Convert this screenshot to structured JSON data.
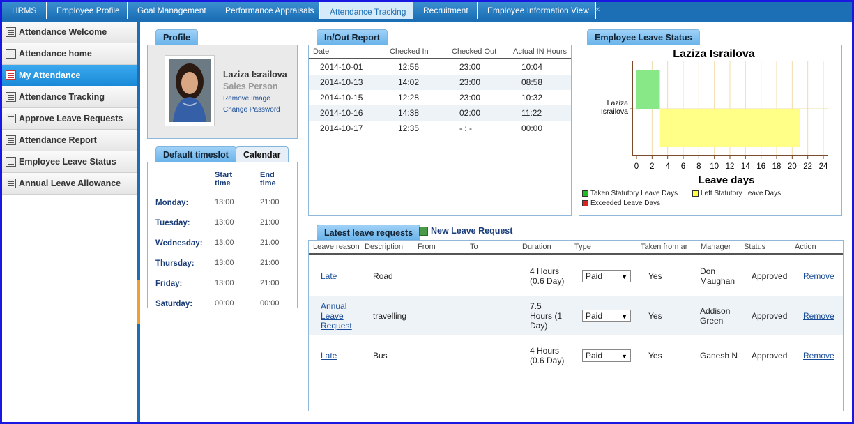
{
  "top_tabs": [
    {
      "label": "HRMS",
      "active": false
    },
    {
      "label": "Employee Profile",
      "active": false
    },
    {
      "label": "Goal Management",
      "active": false
    },
    {
      "label": "Performance Appraisals",
      "active": false
    },
    {
      "label": "Attendance Tracking",
      "active": true
    },
    {
      "label": "Recruitment",
      "active": false
    },
    {
      "label": "Employee Information View",
      "active": false
    }
  ],
  "sidebar": {
    "items": [
      {
        "label": "Attendance Welcome",
        "active": false
      },
      {
        "label": "Attendance home",
        "active": false
      },
      {
        "label": "My Attendance",
        "active": true
      },
      {
        "label": "Attendance Tracking",
        "active": false
      },
      {
        "label": "Approve Leave Requests",
        "active": false
      },
      {
        "label": "Attendance Report",
        "active": false
      },
      {
        "label": "Employee Leave Status",
        "active": false
      },
      {
        "label": "Annual Leave Allowance",
        "active": false
      }
    ]
  },
  "profile": {
    "tab": "Profile",
    "name": "Laziza Israilova",
    "role": "Sales Person",
    "remove_image": "Remove Image",
    "change_password": "Change Password"
  },
  "timeslot": {
    "tab_default": "Default timeslot",
    "tab_calendar": "Calendar",
    "col_start": "Start time",
    "col_end": "End time",
    "rows": [
      {
        "day": "Monday:",
        "start": "13:00",
        "end": "21:00"
      },
      {
        "day": "Tuesday:",
        "start": "13:00",
        "end": "21:00"
      },
      {
        "day": "Wednesday:",
        "start": "13:00",
        "end": "21:00"
      },
      {
        "day": "Thursday:",
        "start": "13:00",
        "end": "21:00"
      },
      {
        "day": "Friday:",
        "start": "13:00",
        "end": "21:00"
      },
      {
        "day": "Saturday:",
        "start": "00:00",
        "end": "00:00"
      }
    ]
  },
  "inout": {
    "tab": "In/Out Report",
    "headers": [
      "Date",
      "Checked In",
      "Checked Out",
      "Actual IN Hours"
    ],
    "rows": [
      [
        "2014-10-01",
        "12:56",
        "23:00",
        "10:04"
      ],
      [
        "2014-10-13",
        "14:02",
        "23:00",
        "08:58"
      ],
      [
        "2014-10-15",
        "12:28",
        "23:00",
        "10:32"
      ],
      [
        "2014-10-16",
        "14:38",
        "02:00",
        "11:22"
      ],
      [
        "2014-10-17",
        "12:35",
        "- : -",
        "00:00"
      ]
    ]
  },
  "leave_status": {
    "tab": "Employee Leave Status",
    "legend": [
      {
        "label": "Taken Statutory Leave Days",
        "color": "#22bb22"
      },
      {
        "label": "Left Statutory Leave Days",
        "color": "#ffff44"
      },
      {
        "label": "Exceeded Leave Days",
        "color": "#dd2222"
      }
    ]
  },
  "chart_data": {
    "type": "bar",
    "title": "Laziza Israilova",
    "xlabel": "Leave days",
    "ylabel": "",
    "categories": [
      "Laziza Israilova"
    ],
    "series": [
      {
        "name": "Taken Statutory Leave Days",
        "start": 0,
        "end": 3,
        "color": "#88e888"
      },
      {
        "name": "Left Statutory Leave Days",
        "start": 3,
        "end": 21,
        "color": "#ffff88"
      }
    ],
    "xlim": [
      0,
      24
    ],
    "xticks": [
      "0",
      "2",
      "4",
      "6",
      "8",
      "10",
      "12",
      "14",
      "16",
      "18",
      "20",
      "22",
      "24"
    ],
    "grid": true
  },
  "leave_requests": {
    "tab": "Latest leave requests",
    "new_link": "New Leave Request",
    "headers": [
      "Leave reason",
      "Description",
      "From",
      "To",
      "Duration",
      "Type",
      "Taken from ar",
      "Manager",
      "Status",
      "Action"
    ],
    "rows": [
      {
        "reason": "Late",
        "description": "Road",
        "from": "",
        "to": "",
        "duration": "4 Hours (0.6 Day)",
        "type": "Paid",
        "taken": "Yes",
        "manager": "Don Maughan",
        "status": "Approved",
        "action": "Remove"
      },
      {
        "reason": "Annual Leave Request",
        "description": "travelling",
        "from": "",
        "to": "",
        "duration": "7.5 Hours (1 Day)",
        "type": "Paid",
        "taken": "Yes",
        "manager": "Addison Green",
        "status": "Approved",
        "action": "Remove"
      },
      {
        "reason": "Late",
        "description": "Bus",
        "from": "",
        "to": "",
        "duration": "4 Hours (0.6 Day)",
        "type": "Paid",
        "taken": "Yes",
        "manager": "Ganesh N",
        "status": "Approved",
        "action": "Remove"
      }
    ]
  }
}
